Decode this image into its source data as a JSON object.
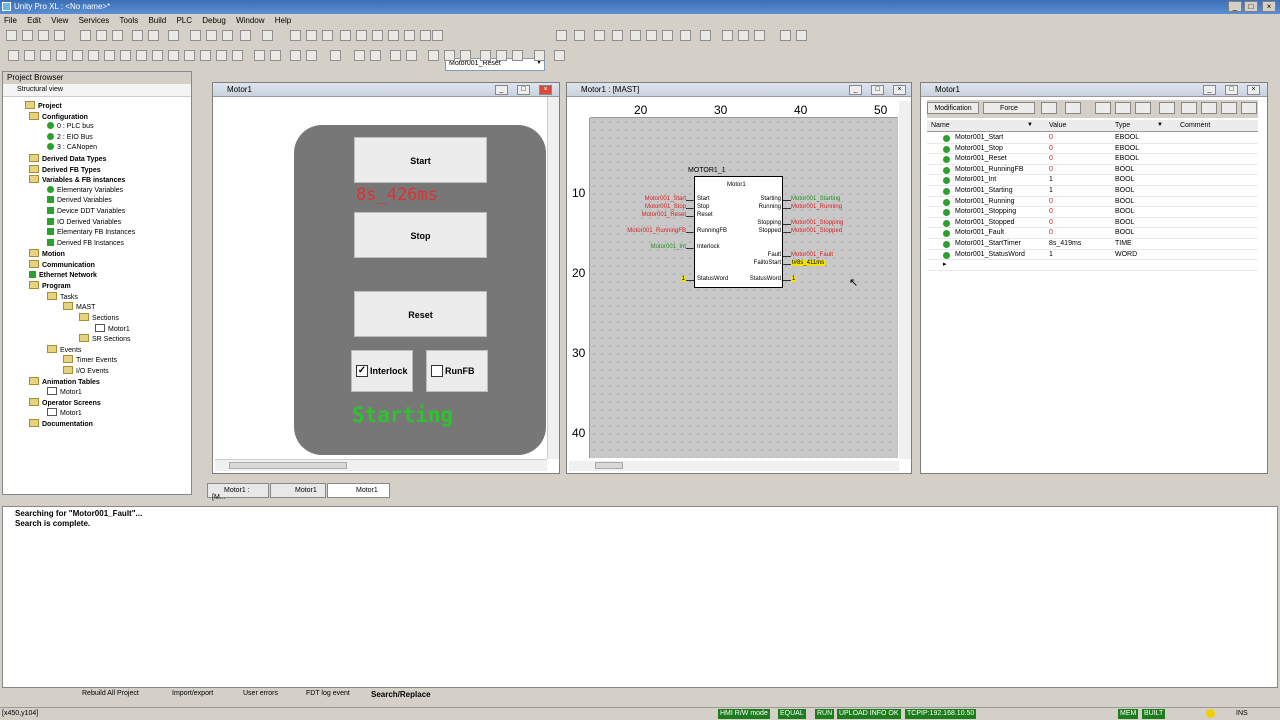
{
  "app": {
    "title": "Unity Pro XL : <No name>*"
  },
  "menu": [
    "File",
    "Edit",
    "View",
    "Services",
    "Tools",
    "Build",
    "PLC",
    "Debug",
    "Window",
    "Help"
  ],
  "toolbar": {
    "combo_value": "Motor001_Reset"
  },
  "project_browser": {
    "title": "Project Browser",
    "view_label": "Structural view",
    "items": [
      {
        "label": "Project",
        "bold": true
      },
      {
        "label": "Configuration",
        "bold": true
      },
      {
        "label": "0 : PLC bus",
        "bold": false
      },
      {
        "label": "2 : EIO Bus",
        "bold": false
      },
      {
        "label": "3 : CANopen",
        "bold": false
      },
      {
        "label": "Derived Data Types",
        "bold": true
      },
      {
        "label": "Derived FB Types",
        "bold": true
      },
      {
        "label": "Variables & FB instances",
        "bold": true
      },
      {
        "label": "Elementary Variables",
        "bold": false
      },
      {
        "label": "Derived Variables",
        "bold": false
      },
      {
        "label": "Device DDT Variables",
        "bold": false
      },
      {
        "label": "IO Derived Variables",
        "bold": false
      },
      {
        "label": "Elementary FB Instances",
        "bold": false
      },
      {
        "label": "Derived FB Instances",
        "bold": false
      },
      {
        "label": "Motion",
        "bold": true
      },
      {
        "label": "Communication",
        "bold": true
      },
      {
        "label": "Ethernet Network",
        "bold": true
      },
      {
        "label": "Program",
        "bold": true
      },
      {
        "label": "Tasks",
        "bold": false
      },
      {
        "label": "MAST",
        "bold": false
      },
      {
        "label": "Sections",
        "bold": false
      },
      {
        "label": "Motor1",
        "bold": false
      },
      {
        "label": "SR Sections",
        "bold": false
      },
      {
        "label": "Events",
        "bold": false
      },
      {
        "label": "Timer Events",
        "bold": false
      },
      {
        "label": "I/O Events",
        "bold": false
      },
      {
        "label": "Animation Tables",
        "bold": true
      },
      {
        "label": "Motor1",
        "bold": false
      },
      {
        "label": "Operator Screens",
        "bold": true
      },
      {
        "label": "Motor1",
        "bold": false
      },
      {
        "label": "Documentation",
        "bold": true
      }
    ]
  },
  "hmi_window": {
    "title": "Motor1",
    "start_label": "Start",
    "stop_label": "Stop",
    "reset_label": "Reset",
    "timer_text": "8s_426ms",
    "interlock_label": "Interlock",
    "interlock_checked": "✓",
    "runfb_label": "RunFB",
    "status_text": "Starting",
    "status_color": "#2fc22f",
    "timer_color": "#e03030"
  },
  "fbd_window": {
    "title": "Motor1 : [MAST]",
    "ruler_top": [
      "20",
      "30",
      "40",
      "50"
    ],
    "ruler_left": [
      "10",
      "20",
      "30",
      "40"
    ],
    "instance_name": "MOTOR1_1",
    "block_type": "Motor1",
    "inputs": [
      {
        "pin": "Start",
        "var": "Motor001_Start",
        "color": "red"
      },
      {
        "pin": "Stop",
        "var": "Motor001_Stop",
        "color": "red"
      },
      {
        "pin": "Reset",
        "var": "Motor001_Reset",
        "color": "red"
      },
      {
        "pin": "RunningFB",
        "var": "Motor001_RunningFB",
        "color": "red"
      },
      {
        "pin": "Interlock",
        "var": "Motor001_Int",
        "color": "grn"
      },
      {
        "pin": "StatusWord",
        "var": "1",
        "color": "yel"
      }
    ],
    "outputs": [
      {
        "pin": "Starting",
        "var": "Motor001_Starting",
        "color": "grn"
      },
      {
        "pin": "Running",
        "var": "Motor001_Running",
        "color": "red"
      },
      {
        "pin": "Stopping",
        "var": "Motor001_Stopping",
        "color": "red"
      },
      {
        "pin": "Stopped",
        "var": "Motor001_Stopped",
        "color": "red"
      },
      {
        "pin": "Fault",
        "var": "Motor001_Fault",
        "color": "red"
      },
      {
        "pin": "FailtoStart",
        "var": "t#8s_411ms",
        "color": "yel"
      },
      {
        "pin": "StatusWord",
        "var": "1",
        "color": "yel"
      }
    ]
  },
  "anim_table": {
    "title": "Motor1",
    "modification_label": "Modification",
    "force_label": "Force",
    "columns": [
      "Name",
      "Value",
      "Type",
      "Comment"
    ],
    "rows": [
      {
        "name": "Motor001_Start",
        "value": "0",
        "type": "EBOOL",
        "vcolor": "red"
      },
      {
        "name": "Motor001_Stop",
        "value": "0",
        "type": "EBOOL",
        "vcolor": "red"
      },
      {
        "name": "Motor001_Reset",
        "value": "0",
        "type": "EBOOL",
        "vcolor": "red"
      },
      {
        "name": "Motor001_RunningFB",
        "value": "0",
        "type": "BOOL",
        "vcolor": "red"
      },
      {
        "name": "Motor001_Int",
        "value": "1",
        "type": "BOOL",
        "vcolor": "blk"
      },
      {
        "name": "Motor001_Starting",
        "value": "1",
        "type": "BOOL",
        "vcolor": "blk"
      },
      {
        "name": "Motor001_Running",
        "value": "0",
        "type": "BOOL",
        "vcolor": "red"
      },
      {
        "name": "Motor001_Stopping",
        "value": "0",
        "type": "BOOL",
        "vcolor": "red"
      },
      {
        "name": "Motor001_Stopped",
        "value": "0",
        "type": "BOOL",
        "vcolor": "red"
      },
      {
        "name": "Motor001_Fault",
        "value": "0",
        "type": "BOOL",
        "vcolor": "red"
      },
      {
        "name": "Motor001_StartTimer",
        "value": "8s_419ms",
        "type": "TIME",
        "vcolor": "blk"
      },
      {
        "name": "Motor001_StatusWord",
        "value": "1",
        "type": "WORD",
        "vcolor": "blk"
      }
    ]
  },
  "doc_tabs": [
    "Motor1 : [M...",
    "Motor1",
    "Motor1"
  ],
  "output": {
    "lines": [
      "Searching for \"Motor001_Fault\"...",
      "Search is complete."
    ],
    "tabs": [
      "Rebuild All Project",
      "Import/export",
      "User errors",
      "FDT log event",
      "Search/Replace"
    ]
  },
  "status_bar": {
    "coords": "[x450,y104]",
    "items": [
      "HMI R/W mode",
      "EQUAL",
      "RUN",
      "UPLOAD INFO OK",
      "TCPIP:192.168.10.50",
      "MEM",
      "BUILT"
    ],
    "ins": "INS"
  }
}
